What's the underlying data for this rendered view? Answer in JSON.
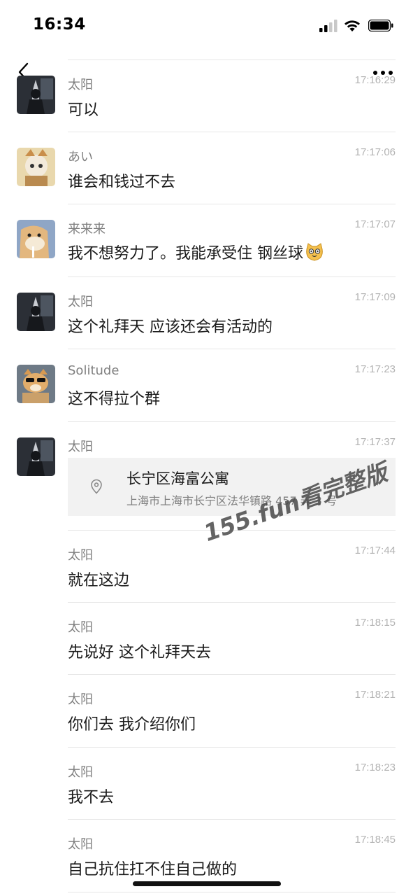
{
  "status_bar": {
    "time": "16:34"
  },
  "messages": [
    {
      "name": "太阳",
      "time": "17:16:29",
      "text": "可以",
      "avatar": "warrior-avatar"
    },
    {
      "name": "あい",
      "time": "17:17:06",
      "text": "谁会和钱过不去",
      "avatar": "cat-avatar"
    },
    {
      "name": "来来来",
      "time": "17:17:07",
      "text": "我不想努力了。我能承受住  钢丝球",
      "avatar": "dog-avatar",
      "emoji": "cat-face-emoji"
    },
    {
      "name": "太阳",
      "time": "17:17:09",
      "text": "这个礼拜天 应该还会有活动的",
      "avatar": "warrior-avatar"
    },
    {
      "name": "Solitude",
      "time": "17:17:23",
      "text": "这不得拉个群",
      "avatar": "shiba-sunglasses-avatar"
    },
    {
      "name": "太阳",
      "time": "17:17:37",
      "avatar": "warrior-avatar",
      "location": {
        "title": "长宁区海富公寓",
        "address": "上海市上海市长宁区法华镇路 457 弄 3 号"
      }
    },
    {
      "name": "太阳",
      "time": "17:17:44",
      "text": "就在这边"
    },
    {
      "name": "太阳",
      "time": "17:18:15",
      "text": "先说好 这个礼拜天去"
    },
    {
      "name": "太阳",
      "time": "17:18:21",
      "text": "你们去 我介绍你们"
    },
    {
      "name": "太阳",
      "time": "17:18:23",
      "text": "我不去"
    },
    {
      "name": "太阳",
      "time": "17:18:45",
      "text": "自己抗住扛不住自己做的"
    }
  ],
  "watermark": "155.fun看完整版",
  "colors": {
    "background": "#ffffff",
    "card": "#f2f2f2",
    "muted": "#7f7f7f",
    "timestamp": "#b3b3b3"
  }
}
